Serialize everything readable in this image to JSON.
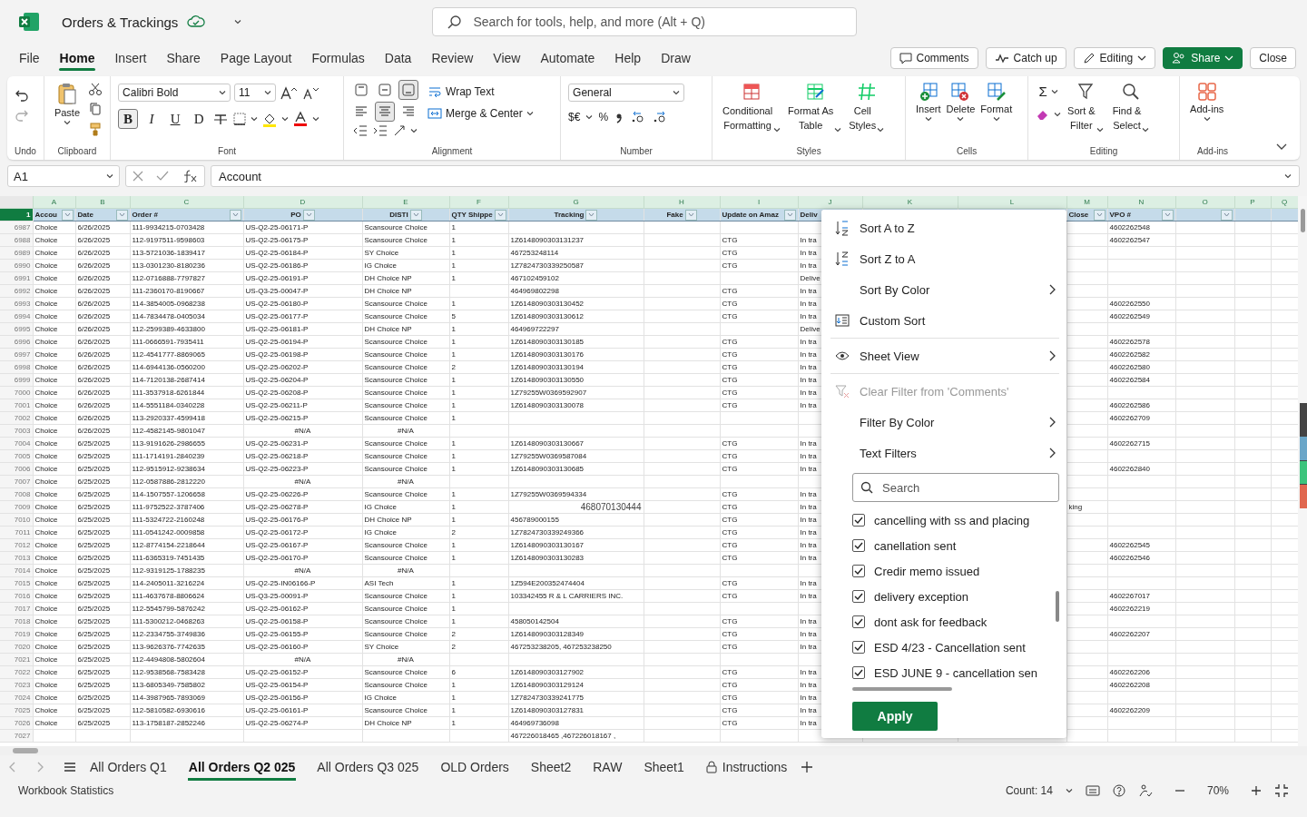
{
  "app": {
    "title": "Orders & Trackings",
    "search_placeholder": "Search for tools, help, and more (Alt + Q)"
  },
  "menu": [
    {
      "label": "File",
      "selected": false
    },
    {
      "label": "Home",
      "selected": true
    },
    {
      "label": "Insert",
      "selected": false
    },
    {
      "label": "Share",
      "selected": false
    },
    {
      "label": "Page Layout",
      "selected": false
    },
    {
      "label": "Formulas",
      "selected": false
    },
    {
      "label": "Data",
      "selected": false
    },
    {
      "label": "Review",
      "selected": false
    },
    {
      "label": "View",
      "selected": false
    },
    {
      "label": "Automate",
      "selected": false
    },
    {
      "label": "Help",
      "selected": false
    },
    {
      "label": "Draw",
      "selected": false
    }
  ],
  "actions": [
    {
      "label": "Comments",
      "kind": "comments"
    },
    {
      "label": "Catch up",
      "kind": "catchup"
    },
    {
      "label": "Editing",
      "kind": "editing"
    },
    {
      "label": "Share",
      "kind": "share"
    },
    {
      "label": "Close",
      "kind": "close"
    }
  ],
  "ribbon": {
    "undo": {
      "group": "Undo",
      "redo_disabled": true
    },
    "clipboard": {
      "group": "Clipboard",
      "paste": "Paste"
    },
    "font": {
      "group": "Font",
      "family": "Calibri Bold",
      "size": "11",
      "formats": [
        {
          "label": "B",
          "selected": true
        },
        {
          "label": "I",
          "selected": false
        },
        {
          "label": "U",
          "selected": false
        },
        {
          "label": "D",
          "selected": false
        }
      ]
    },
    "alignment": {
      "group": "Alignment",
      "vertical": [
        {
          "selected": false
        },
        {
          "selected": false
        },
        {
          "selected": true
        }
      ],
      "horizontal": [
        {
          "selected": false
        },
        {
          "selected": true
        },
        {
          "selected": false
        }
      ],
      "wrap": "Wrap Text",
      "merge": "Merge & Center"
    },
    "number": {
      "group": "Number",
      "format": "General",
      "currency": "$€",
      "percent": "%"
    },
    "styles": {
      "group": "Styles",
      "buttons": [
        {
          "label": "Conditional\nFormatting",
          "kind": "conditional"
        },
        {
          "label": "Format As\nTable",
          "kind": "table"
        },
        {
          "label": "Cell\nStyles",
          "kind": "cell_styles"
        }
      ]
    },
    "cells": {
      "group": "Cells",
      "buttons": [
        {
          "label": "Insert",
          "kind": "insert"
        },
        {
          "label": "Delete",
          "kind": "delete"
        },
        {
          "label": "Format",
          "kind": "format"
        }
      ]
    },
    "editing": {
      "group": "Editing",
      "autosum": "Σ",
      "buttons": [
        {
          "label": "Sort &\nFilter",
          "kind": "sort"
        },
        {
          "label": "Find &\nSelect",
          "kind": "find"
        }
      ]
    },
    "addins": {
      "group": "Add-ins",
      "label": "Add-ins"
    }
  },
  "formula_bar": {
    "name_box": "A1",
    "formula": "Account"
  },
  "grid": {
    "header_row_number": "1",
    "columns": [
      {
        "letter": "A",
        "header": "Accou",
        "filter": true
      },
      {
        "letter": "B",
        "header": "Date",
        "filter": true
      },
      {
        "letter": "C",
        "header": "Order #",
        "filter": true
      },
      {
        "letter": "D",
        "header": "PO",
        "filter": true
      },
      {
        "letter": "E",
        "header": "DISTI",
        "filter": true
      },
      {
        "letter": "F",
        "header": "QTY Shippe",
        "filter": true
      },
      {
        "letter": "G",
        "header": "Tracking",
        "filter": true
      },
      {
        "letter": "H",
        "header": "Fake",
        "filter": true
      },
      {
        "letter": "I",
        "header": "Update on Amaz",
        "filter": true
      },
      {
        "letter": "J",
        "header": "Deliv",
        "filter": false
      },
      {
        "letter": "K",
        "filter": false
      },
      {
        "letter": "L",
        "filter": false
      },
      {
        "letter": "M",
        "header": "Close",
        "filter": true
      },
      {
        "letter": "N",
        "header": "VPO #",
        "filter": true
      },
      {
        "letter": "O",
        "filter": true
      },
      {
        "letter": "P",
        "filter": false
      },
      {
        "letter": "Q",
        "filter": false
      }
    ],
    "rows": [
      {
        "number": "6987",
        "account": "Choice",
        "date": "6/26/2025",
        "order": "111-9934215-0703428",
        "po": "US-Q2-25-06171-P",
        "disti": "Scansource Choice",
        "qty": "1",
        "vpo": "4602262548"
      },
      {
        "number": "6988",
        "account": "Choice",
        "date": "6/26/2025",
        "order": "112-9197511-9598603",
        "po": "US-Q2-25-06175-P",
        "disti": "Scansource Choice",
        "qty": "1",
        "tracking": "1Z6148090303131237",
        "update": "CTG",
        "delivery": "In tra",
        "vpo": "4602262547"
      },
      {
        "number": "6989",
        "account": "Choice",
        "date": "6/26/2025",
        "order": "113-5721036-1839417",
        "po": "US-Q2-25-06184-P",
        "disti": "SY Choice",
        "qty": "1",
        "tracking": "467253248114",
        "update": "CTG",
        "delivery": "In tra"
      },
      {
        "number": "6990",
        "account": "Choice",
        "date": "6/26/2025",
        "order": "113-0301230-8180236",
        "po": "US-Q2-25-06186-P",
        "disti": "IG Choice",
        "qty": "1",
        "tracking": "1Z7824730339250587",
        "update": "CTG",
        "delivery": "In tra"
      },
      {
        "number": "6991",
        "account": "Choice",
        "date": "6/26/2025",
        "order": "112-0716888-7797827",
        "po": "US-Q2-25-06191-P",
        "disti": "DH Choice NP",
        "qty": "1",
        "tracking": "467102459102",
        "delivery": "Delive"
      },
      {
        "number": "6992",
        "account": "Choice",
        "date": "6/26/2025",
        "order": "111-2360170-8190667",
        "po": "US-Q3-25-00047-P",
        "disti": "DH Choice NP",
        "tracking": "464969802298",
        "update": "CTG",
        "delivery": "In tra"
      },
      {
        "number": "6993",
        "account": "Choice",
        "date": "6/26/2025",
        "order": "114-3854005-0968238",
        "po": "US-Q2-25-06180-P",
        "disti": "Scansource Choice",
        "qty": "1",
        "tracking": "1Z6148090303130452",
        "update": "CTG",
        "delivery": "In tra",
        "vpo": "4602262550"
      },
      {
        "number": "6994",
        "account": "Choice",
        "date": "6/26/2025",
        "order": "114-7834478-0405034",
        "po": "US-Q2-25-06177-P",
        "disti": "Scansource Choice",
        "qty": "5",
        "tracking": "1Z6148090303130612",
        "update": "CTG",
        "delivery": "In tra",
        "vpo": "4602262549"
      },
      {
        "number": "6995",
        "account": "Choice",
        "date": "6/26/2025",
        "order": "112-2599389-4633800",
        "po": "US-Q2-25-06181-P",
        "disti": "DH Choice NP",
        "qty": "1",
        "tracking": "464969722297",
        "delivery": "Delive"
      },
      {
        "number": "6996",
        "account": "Choice",
        "date": "6/26/2025",
        "order": "111-0666591-7935411",
        "po": "US-Q2-25-06194-P",
        "disti": "Scansource Choice",
        "qty": "1",
        "tracking": "1Z6148090303130185",
        "update": "CTG",
        "delivery": "In tra",
        "vpo": "4602262578"
      },
      {
        "number": "6997",
        "account": "Choice",
        "date": "6/26/2025",
        "order": "112-4541777-8869065",
        "po": "US-Q2-25-06198-P",
        "disti": "Scansource Choice",
        "qty": "1",
        "tracking": "1Z6148090303130176",
        "update": "CTG",
        "delivery": "In tra",
        "vpo": "4602262582"
      },
      {
        "number": "6998",
        "account": "Choice",
        "date": "6/26/2025",
        "order": "114-6944136-0560200",
        "po": "US-Q2-25-06202-P",
        "disti": "Scansource Choice",
        "qty": "2",
        "tracking": "1Z6148090303130194",
        "update": "CTG",
        "delivery": "In tra",
        "vpo": "4602262580"
      },
      {
        "number": "6999",
        "account": "Choice",
        "date": "6/26/2025",
        "order": "114-7120138-2687414",
        "po": "US-Q2-25-06204-P",
        "disti": "Scansource Choice",
        "qty": "1",
        "tracking": "1Z6148090303130550",
        "update": "CTG",
        "delivery": "In tra",
        "vpo": "4602262584"
      },
      {
        "number": "7000",
        "account": "Choice",
        "date": "6/26/2025",
        "order": "111-3537918-6261844",
        "po": "US-Q2-25-06208-P",
        "disti": "Scansource Choice",
        "qty": "1",
        "tracking": "1Z79255W0369592907",
        "update": "CTG",
        "delivery": "In tra"
      },
      {
        "number": "7001",
        "account": "Choice",
        "date": "6/26/2025",
        "order": "114-5551184-0340228",
        "po": "US-Q2-25-06211-P",
        "disti": "Scansource Choice",
        "qty": "1",
        "tracking": "1Z6148090303130078",
        "update": "CTG",
        "delivery": "In tra",
        "vpo": "4602262586"
      },
      {
        "number": "7002",
        "account": "Choice",
        "date": "6/26/2025",
        "order": "113-2920337-4599418",
        "po": "US-Q2-25-06215-P",
        "disti": "Scansource Choice",
        "qty": "1",
        "vpo": "4602262709"
      },
      {
        "number": "7003",
        "account": "Choice",
        "date": "6/26/2025",
        "order": "112-4582145-9801047",
        "po": "#N/A",
        "disti": "#N/A",
        "kind": "lookup_error"
      },
      {
        "number": "7004",
        "account": "Choice",
        "date": "6/25/2025",
        "order": "113-9191626-2986655",
        "po": "US-Q2-25-06231-P",
        "disti": "Scansource Choice",
        "qty": "1",
        "tracking": "1Z6148090303130667",
        "update": "CTG",
        "delivery": "In tra",
        "vpo": "4602262715"
      },
      {
        "number": "7005",
        "account": "Choice",
        "date": "6/25/2025",
        "order": "111-1714191-2840239",
        "po": "US-Q2-25-06218-P",
        "disti": "Scansource Choice",
        "qty": "1",
        "tracking": "1Z79255W0369587084",
        "update": "CTG",
        "delivery": "In tra"
      },
      {
        "number": "7006",
        "account": "Choice",
        "date": "6/25/2025",
        "order": "112-9515912-9238634",
        "po": "US-Q2-25-06223-P",
        "disti": "Scansource Choice",
        "qty": "1",
        "tracking": "1Z6148090303130685",
        "update": "CTG",
        "delivery": "In tra",
        "vpo": "4602262840"
      },
      {
        "number": "7007",
        "account": "Choice",
        "date": "6/25/2025",
        "order": "112-0587886-2812220",
        "po": "#N/A",
        "disti": "#N/A",
        "kind": "lookup_error"
      },
      {
        "number": "7008",
        "account": "Choice",
        "date": "6/25/2025",
        "order": "114-1507557-1206658",
        "po": "US-Q2-25-06226-P",
        "disti": "Scansource Choice",
        "qty": "1",
        "tracking": "1Z79255W0369594334",
        "update": "CTG",
        "delivery": "In tra"
      },
      {
        "number": "7009",
        "account": "Choice",
        "date": "6/25/2025",
        "order": "111-9752522-3787406",
        "po": "US-Q2-25-06278-P",
        "disti": "IG Choice",
        "qty": "1",
        "tracking": "468070130444",
        "update": "CTG",
        "delivery": "In tra",
        "close": "king",
        "kind": "number_tracking"
      },
      {
        "number": "7010",
        "account": "Choice",
        "date": "6/25/2025",
        "order": "111-5324722-2160248",
        "po": "US-Q2-25-06176-P",
        "disti": "DH Choice NP",
        "qty": "1",
        "tracking": "456789000155",
        "update": "CTG",
        "delivery": "In tra"
      },
      {
        "number": "7011",
        "account": "Choice",
        "date": "6/25/2025",
        "order": "111-0541242-0009858",
        "po": "US-Q2-25-06172-P",
        "disti": "IG Choice",
        "qty": "2",
        "tracking": "1Z7824730339249366",
        "update": "CTG",
        "delivery": "In tra"
      },
      {
        "number": "7012",
        "account": "Choice",
        "date": "6/25/2025",
        "order": "112-8774154-2218644",
        "po": "US-Q2-25-06167-P",
        "disti": "Scansource Choice",
        "qty": "1",
        "tracking": "1Z6148090303130167",
        "update": "CTG",
        "delivery": "In tra",
        "vpo": "4602262545"
      },
      {
        "number": "7013",
        "account": "Choice",
        "date": "6/25/2025",
        "order": "111-6365319-7451435",
        "po": "US-Q2-25-06170-P",
        "disti": "Scansource Choice",
        "qty": "1",
        "tracking": "1Z6148090303130283",
        "update": "CTG",
        "delivery": "In tra",
        "vpo": "4602262546"
      },
      {
        "number": "7014",
        "account": "Choice",
        "date": "6/25/2025",
        "order": "112-9319125-1788235",
        "po": "#N/A",
        "disti": "#N/A",
        "kind": "lookup_error"
      },
      {
        "number": "7015",
        "account": "Choice",
        "date": "6/25/2025",
        "order": "114-2405011-3216224",
        "po": "US-Q2-25-IN06166-P",
        "disti": "ASI Tech",
        "qty": "1",
        "tracking": "1Z594E200352474404",
        "update": "CTG",
        "delivery": "In tra"
      },
      {
        "number": "7016",
        "account": "Choice",
        "date": "6/25/2025",
        "order": "111-4637678-8806624",
        "po": "US-Q3-25-00091-P",
        "disti": "Scansource Choice",
        "qty": "1",
        "tracking": "103342455 R & L CARRIERS INC.",
        "update": "CTG",
        "delivery": "In tra",
        "vpo": "4602267017"
      },
      {
        "number": "7017",
        "account": "Choice",
        "date": "6/25/2025",
        "order": "112-5545799-5876242",
        "po": "US-Q2-25-06162-P",
        "disti": "Scansource Choice",
        "qty": "1",
        "vpo": "4602262219"
      },
      {
        "number": "7018",
        "account": "Choice",
        "date": "6/25/2025",
        "order": "111-5300212-0468263",
        "po": "US-Q2-25-06158-P",
        "disti": "Scansource Choice",
        "qty": "1",
        "tracking": "458050142504",
        "update": "CTG",
        "delivery": "In tra"
      },
      {
        "number": "7019",
        "account": "Choice",
        "date": "6/25/2025",
        "order": "112-2334755-3749836",
        "po": "US-Q2-25-06155-P",
        "disti": "Scansource Choice",
        "qty": "2",
        "tracking": "1Z6148090303128349",
        "update": "CTG",
        "delivery": "In tra",
        "vpo": "4602262207"
      },
      {
        "number": "7020",
        "account": "Choice",
        "date": "6/25/2025",
        "order": "113-9626376-7742635",
        "po": "US-Q2-25-06160-P",
        "disti": "SY Choice",
        "qty": "2",
        "tracking": "467253238205, 467253238250",
        "update": "CTG",
        "delivery": "In tra"
      },
      {
        "number": "7021",
        "account": "Choice",
        "date": "6/25/2025",
        "order": "112-4494808-5802604",
        "po": "#N/A",
        "disti": "#N/A",
        "kind": "lookup_error"
      },
      {
        "number": "7022",
        "account": "Choice",
        "date": "6/25/2025",
        "order": "112-9538568-7583428",
        "po": "US-Q2-25-06152-P",
        "disti": "Scansource Choice",
        "qty": "6",
        "tracking": "1Z6148090303127902",
        "update": "CTG",
        "delivery": "In tra",
        "vpo": "4602262206"
      },
      {
        "number": "7023",
        "account": "Choice",
        "date": "6/25/2025",
        "order": "113-6805349-7585802",
        "po": "US-Q2-25-06154-P",
        "disti": "Scansource Choice",
        "qty": "1",
        "tracking": "1Z6148090303129124",
        "update": "CTG",
        "delivery": "In tra",
        "vpo": "4602262208"
      },
      {
        "number": "7024",
        "account": "Choice",
        "date": "6/25/2025",
        "order": "114-3987965-7893069",
        "po": "US-Q2-25-06156-P",
        "disti": "IG Choice",
        "qty": "1",
        "tracking": "1Z7824730339241775",
        "update": "CTG",
        "delivery": "In tra"
      },
      {
        "number": "7025",
        "account": "Choice",
        "date": "6/25/2025",
        "order": "112-5810582-6930616",
        "po": "US-Q2-25-06161-P",
        "disti": "Scansource Choice",
        "qty": "1",
        "tracking": "1Z6148090303127831",
        "update": "CTG",
        "delivery": "In tra",
        "vpo": "4602262209"
      },
      {
        "number": "7026",
        "account": "Choice",
        "date": "6/25/2025",
        "order": "113-1758187-2852246",
        "po": "US-Q2-25-06274-P",
        "disti": "DH Choice NP",
        "qty": "1",
        "tracking": "464969736098",
        "update": "CTG",
        "delivery": "In tra"
      },
      {
        "number": "7027",
        "tracking": "467226018465 ,467226018167 ,"
      }
    ]
  },
  "filter_menu": {
    "groups": [
      [
        {
          "label": "Sort A to Z",
          "kind": "sort_asc",
          "submenu": false,
          "disabled": false
        },
        {
          "label": "Sort Z to A",
          "kind": "sort_desc",
          "submenu": false,
          "disabled": false
        },
        {
          "label": "Sort By Color",
          "kind": "plain",
          "submenu": true,
          "disabled": false
        },
        {
          "label": "Custom Sort",
          "kind": "custom_sort",
          "submenu": false,
          "disabled": false
        }
      ],
      [
        {
          "label": "Sheet View",
          "kind": "sheet_view",
          "submenu": true,
          "disabled": false
        }
      ],
      [
        {
          "label": "Clear Filter from 'Comments'",
          "kind": "clear_filter",
          "submenu": false,
          "disabled": true
        },
        {
          "label": "Filter By Color",
          "kind": "plain",
          "submenu": true,
          "disabled": false
        },
        {
          "label": "Text Filters",
          "kind": "plain",
          "submenu": true,
          "disabled": false
        }
      ]
    ],
    "search_placeholder": "Search",
    "values": [
      {
        "label": "cancelling with ss and placing",
        "checked": true
      },
      {
        "label": "canellation sent",
        "checked": true
      },
      {
        "label": "Credir memo issued",
        "checked": true
      },
      {
        "label": "delivery exception",
        "checked": true
      },
      {
        "label": "dont ask for feedback",
        "checked": true
      },
      {
        "label": "ESD 4/23 - Cancellation sent",
        "checked": true
      },
      {
        "label": "ESD JUNE 9 - cancellation sen",
        "checked": true
      }
    ],
    "apply": "Apply"
  },
  "sheets": [
    {
      "label": "All Orders Q1",
      "selected": false,
      "locked": false
    },
    {
      "label": "All Orders Q2 025",
      "selected": true,
      "locked": false
    },
    {
      "label": "All Orders Q3 025",
      "selected": false,
      "locked": false
    },
    {
      "label": "OLD Orders",
      "selected": false,
      "locked": false
    },
    {
      "label": "Sheet2",
      "selected": false,
      "locked": false
    },
    {
      "label": "RAW",
      "selected": false,
      "locked": false
    },
    {
      "label": "Sheet1",
      "selected": false,
      "locked": false
    },
    {
      "label": "Instructions",
      "selected": false,
      "locked": true
    }
  ],
  "status_bar": {
    "left": "Workbook Statistics",
    "count": "Count: 14",
    "zoom": "70%"
  }
}
